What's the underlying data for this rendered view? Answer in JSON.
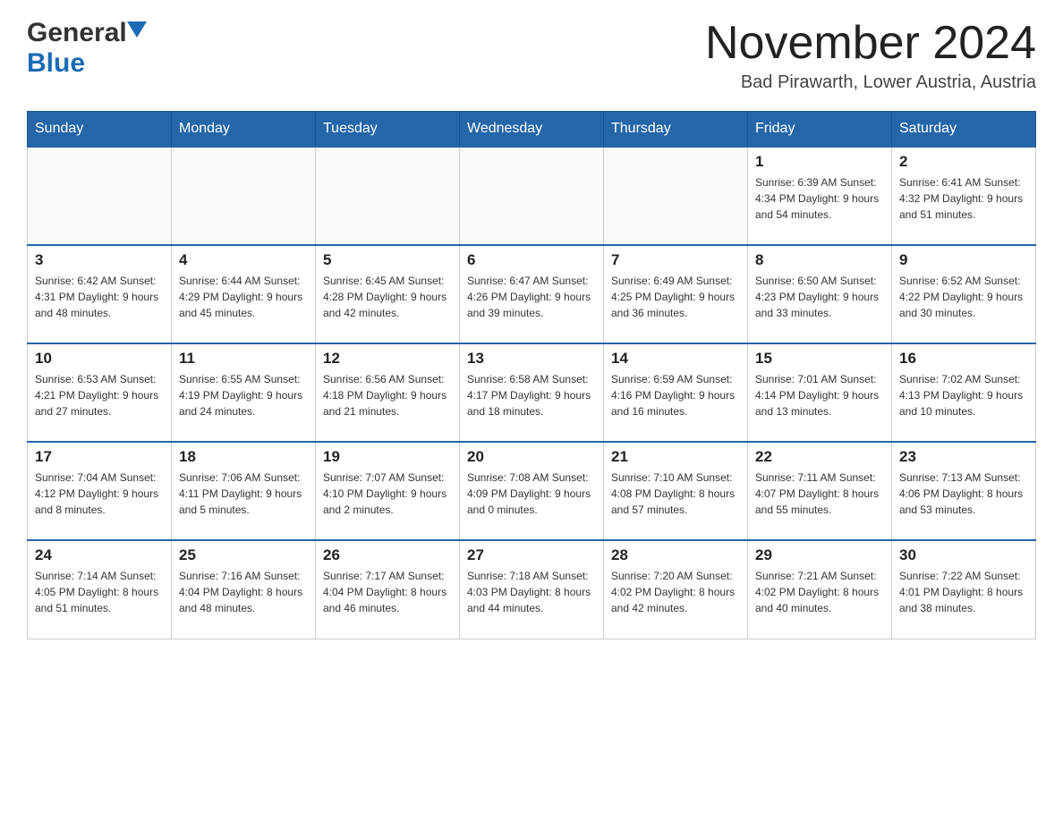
{
  "header": {
    "logo_general": "General",
    "logo_blue": "Blue",
    "title": "November 2024",
    "subtitle": "Bad Pirawarth, Lower Austria, Austria"
  },
  "days_of_week": [
    "Sunday",
    "Monday",
    "Tuesday",
    "Wednesday",
    "Thursday",
    "Friday",
    "Saturday"
  ],
  "weeks": [
    {
      "days": [
        {
          "number": "",
          "info": ""
        },
        {
          "number": "",
          "info": ""
        },
        {
          "number": "",
          "info": ""
        },
        {
          "number": "",
          "info": ""
        },
        {
          "number": "",
          "info": ""
        },
        {
          "number": "1",
          "info": "Sunrise: 6:39 AM\nSunset: 4:34 PM\nDaylight: 9 hours\nand 54 minutes."
        },
        {
          "number": "2",
          "info": "Sunrise: 6:41 AM\nSunset: 4:32 PM\nDaylight: 9 hours\nand 51 minutes."
        }
      ]
    },
    {
      "days": [
        {
          "number": "3",
          "info": "Sunrise: 6:42 AM\nSunset: 4:31 PM\nDaylight: 9 hours\nand 48 minutes."
        },
        {
          "number": "4",
          "info": "Sunrise: 6:44 AM\nSunset: 4:29 PM\nDaylight: 9 hours\nand 45 minutes."
        },
        {
          "number": "5",
          "info": "Sunrise: 6:45 AM\nSunset: 4:28 PM\nDaylight: 9 hours\nand 42 minutes."
        },
        {
          "number": "6",
          "info": "Sunrise: 6:47 AM\nSunset: 4:26 PM\nDaylight: 9 hours\nand 39 minutes."
        },
        {
          "number": "7",
          "info": "Sunrise: 6:49 AM\nSunset: 4:25 PM\nDaylight: 9 hours\nand 36 minutes."
        },
        {
          "number": "8",
          "info": "Sunrise: 6:50 AM\nSunset: 4:23 PM\nDaylight: 9 hours\nand 33 minutes."
        },
        {
          "number": "9",
          "info": "Sunrise: 6:52 AM\nSunset: 4:22 PM\nDaylight: 9 hours\nand 30 minutes."
        }
      ]
    },
    {
      "days": [
        {
          "number": "10",
          "info": "Sunrise: 6:53 AM\nSunset: 4:21 PM\nDaylight: 9 hours\nand 27 minutes."
        },
        {
          "number": "11",
          "info": "Sunrise: 6:55 AM\nSunset: 4:19 PM\nDaylight: 9 hours\nand 24 minutes."
        },
        {
          "number": "12",
          "info": "Sunrise: 6:56 AM\nSunset: 4:18 PM\nDaylight: 9 hours\nand 21 minutes."
        },
        {
          "number": "13",
          "info": "Sunrise: 6:58 AM\nSunset: 4:17 PM\nDaylight: 9 hours\nand 18 minutes."
        },
        {
          "number": "14",
          "info": "Sunrise: 6:59 AM\nSunset: 4:16 PM\nDaylight: 9 hours\nand 16 minutes."
        },
        {
          "number": "15",
          "info": "Sunrise: 7:01 AM\nSunset: 4:14 PM\nDaylight: 9 hours\nand 13 minutes."
        },
        {
          "number": "16",
          "info": "Sunrise: 7:02 AM\nSunset: 4:13 PM\nDaylight: 9 hours\nand 10 minutes."
        }
      ]
    },
    {
      "days": [
        {
          "number": "17",
          "info": "Sunrise: 7:04 AM\nSunset: 4:12 PM\nDaylight: 9 hours\nand 8 minutes."
        },
        {
          "number": "18",
          "info": "Sunrise: 7:06 AM\nSunset: 4:11 PM\nDaylight: 9 hours\nand 5 minutes."
        },
        {
          "number": "19",
          "info": "Sunrise: 7:07 AM\nSunset: 4:10 PM\nDaylight: 9 hours\nand 2 minutes."
        },
        {
          "number": "20",
          "info": "Sunrise: 7:08 AM\nSunset: 4:09 PM\nDaylight: 9 hours\nand 0 minutes."
        },
        {
          "number": "21",
          "info": "Sunrise: 7:10 AM\nSunset: 4:08 PM\nDaylight: 8 hours\nand 57 minutes."
        },
        {
          "number": "22",
          "info": "Sunrise: 7:11 AM\nSunset: 4:07 PM\nDaylight: 8 hours\nand 55 minutes."
        },
        {
          "number": "23",
          "info": "Sunrise: 7:13 AM\nSunset: 4:06 PM\nDaylight: 8 hours\nand 53 minutes."
        }
      ]
    },
    {
      "days": [
        {
          "number": "24",
          "info": "Sunrise: 7:14 AM\nSunset: 4:05 PM\nDaylight: 8 hours\nand 51 minutes."
        },
        {
          "number": "25",
          "info": "Sunrise: 7:16 AM\nSunset: 4:04 PM\nDaylight: 8 hours\nand 48 minutes."
        },
        {
          "number": "26",
          "info": "Sunrise: 7:17 AM\nSunset: 4:04 PM\nDaylight: 8 hours\nand 46 minutes."
        },
        {
          "number": "27",
          "info": "Sunrise: 7:18 AM\nSunset: 4:03 PM\nDaylight: 8 hours\nand 44 minutes."
        },
        {
          "number": "28",
          "info": "Sunrise: 7:20 AM\nSunset: 4:02 PM\nDaylight: 8 hours\nand 42 minutes."
        },
        {
          "number": "29",
          "info": "Sunrise: 7:21 AM\nSunset: 4:02 PM\nDaylight: 8 hours\nand 40 minutes."
        },
        {
          "number": "30",
          "info": "Sunrise: 7:22 AM\nSunset: 4:01 PM\nDaylight: 8 hours\nand 38 minutes."
        }
      ]
    }
  ]
}
